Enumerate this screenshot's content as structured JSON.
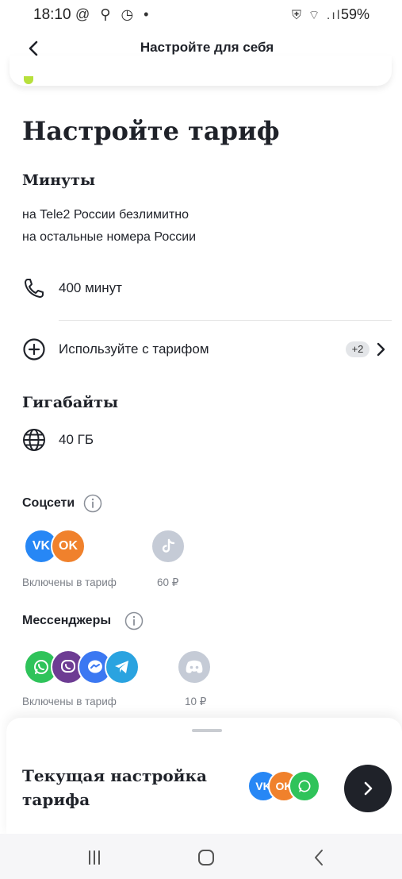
{
  "status_bar": {
    "time": "18:10",
    "left_icons": "@ ⚲ ◷ •",
    "right_icons": "⛨ ⌔ .ıl",
    "battery": "59%"
  },
  "header": {
    "title": "Настройте для себя"
  },
  "page": {
    "title": "Настройте тариф"
  },
  "minutes": {
    "title": "Минуты",
    "line1": "на Tele2 России безлимитно",
    "line2": "на остальные номера России",
    "value": "400  минут"
  },
  "addons": {
    "label": "Используйте с тарифом",
    "badge": "+2"
  },
  "gigabytes": {
    "title": "Гигабайты",
    "value": "40 ГБ"
  },
  "social": {
    "title": "Соцсети",
    "included_caption": "Включены в тариф",
    "vk": "VK",
    "ok": "OK",
    "tiktok_price": "60 ₽"
  },
  "messengers": {
    "title": "Мессенджеры",
    "included_caption": "Включены в тариф",
    "discord_price": "10 ₽"
  },
  "sheet": {
    "title": "Текущая настройка тарифа",
    "vk": "VK",
    "ok": "OK"
  },
  "colors": {
    "accent_dark": "#1f2229",
    "vk": "#2787f5",
    "ok": "#f0812c",
    "whatsapp": "#2fc35a",
    "viber": "#6d3c93",
    "messenger": "#3b78f2",
    "telegram": "#2aa3e0",
    "disabled": "#c5cbd6"
  }
}
